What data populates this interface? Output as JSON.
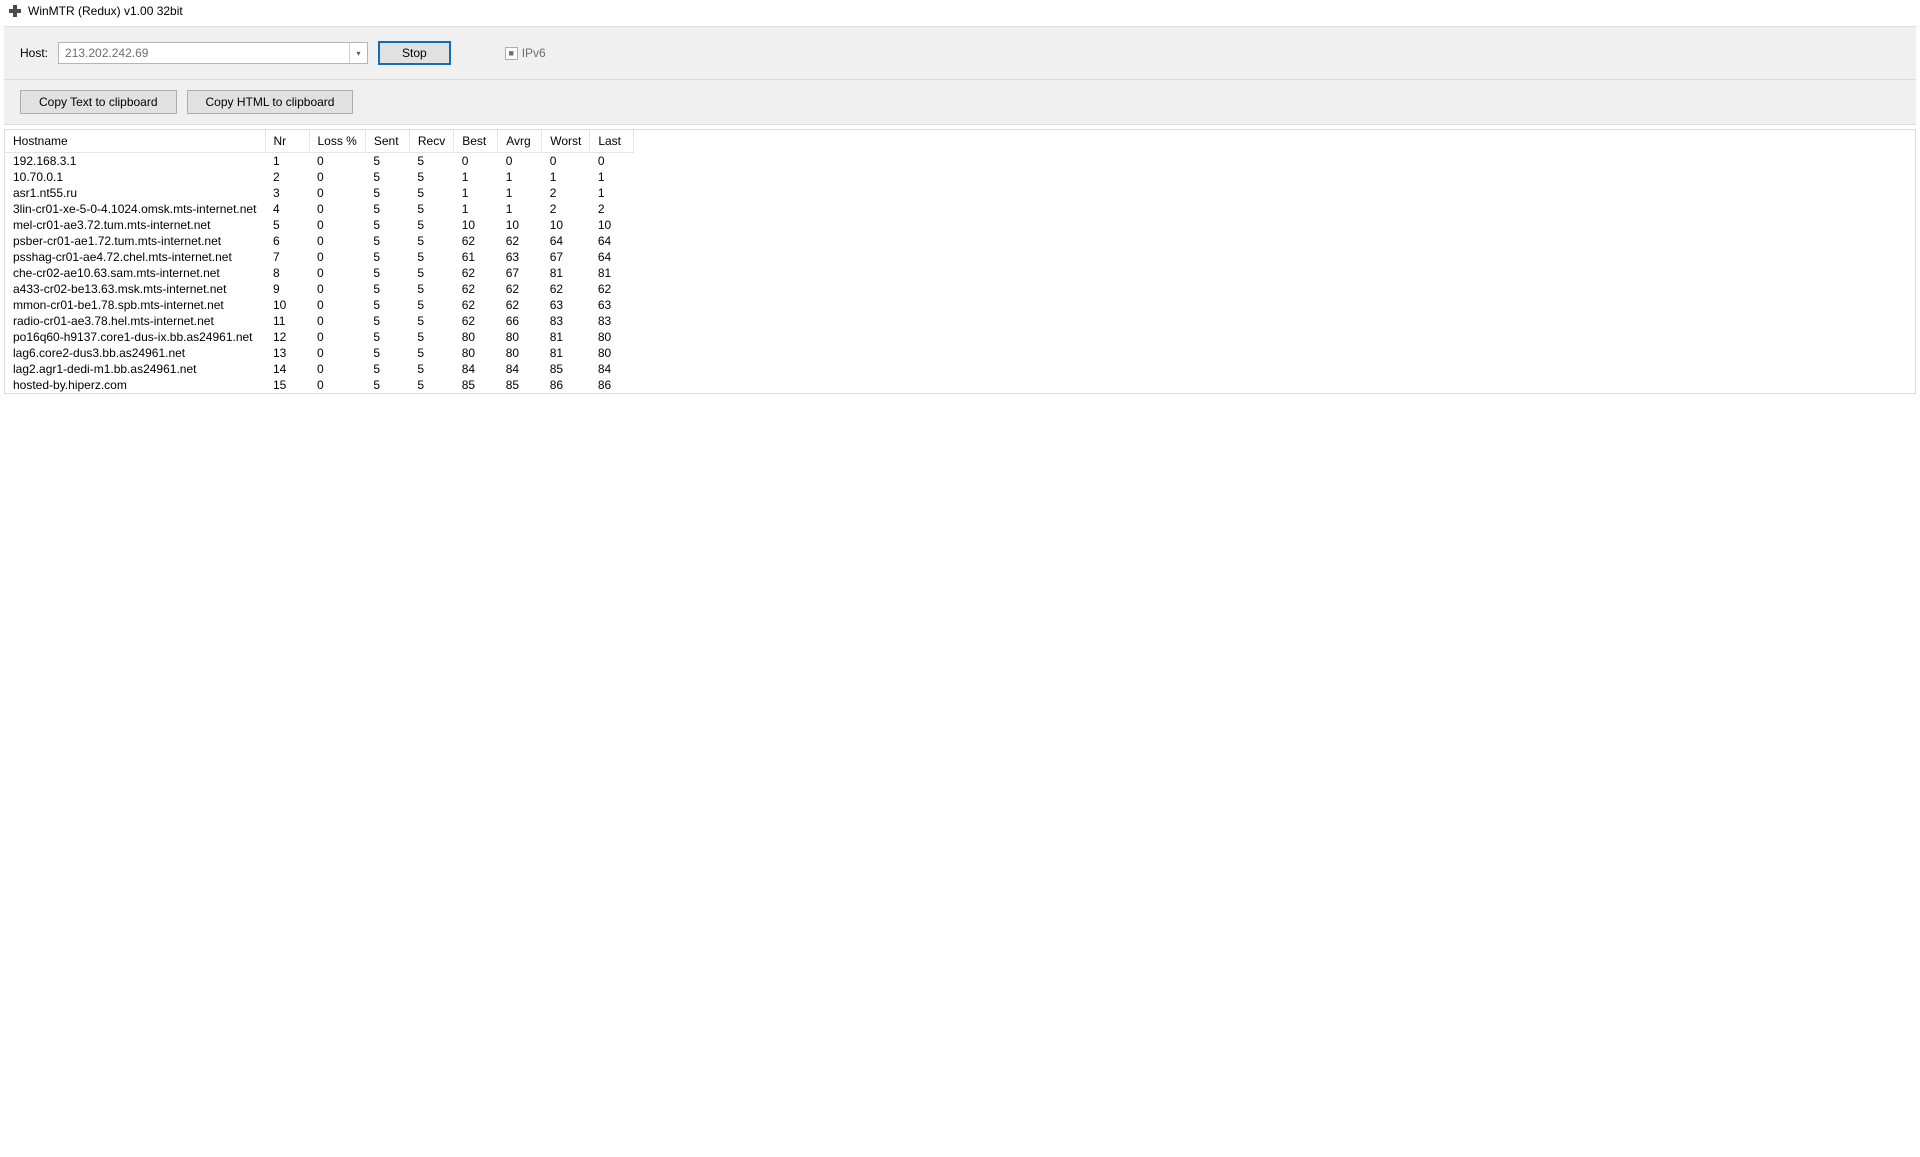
{
  "titlebar": {
    "title": "WinMTR (Redux) v1.00 32bit"
  },
  "toolbar": {
    "host_label": "Host:",
    "host_value": "213.202.242.69",
    "stop_label": "Stop",
    "ipv6_label": "IPv6"
  },
  "secondbar": {
    "copy_text_label": "Copy Text to clipboard",
    "copy_html_label": "Copy HTML to clipboard"
  },
  "table": {
    "headers": {
      "hostname": "Hostname",
      "nr": "Nr",
      "loss": "Loss %",
      "sent": "Sent",
      "recv": "Recv",
      "best": "Best",
      "avrg": "Avrg",
      "worst": "Worst",
      "last": "Last"
    },
    "rows": [
      {
        "hostname": "192.168.3.1",
        "nr": "1",
        "loss": "0",
        "sent": "5",
        "recv": "5",
        "best": "0",
        "avrg": "0",
        "worst": "0",
        "last": "0"
      },
      {
        "hostname": "10.70.0.1",
        "nr": "2",
        "loss": "0",
        "sent": "5",
        "recv": "5",
        "best": "1",
        "avrg": "1",
        "worst": "1",
        "last": "1"
      },
      {
        "hostname": "asr1.nt55.ru",
        "nr": "3",
        "loss": "0",
        "sent": "5",
        "recv": "5",
        "best": "1",
        "avrg": "1",
        "worst": "2",
        "last": "1"
      },
      {
        "hostname": "3lin-cr01-xe-5-0-4.1024.omsk.mts-internet.net",
        "nr": "4",
        "loss": "0",
        "sent": "5",
        "recv": "5",
        "best": "1",
        "avrg": "1",
        "worst": "2",
        "last": "2"
      },
      {
        "hostname": "mel-cr01-ae3.72.tum.mts-internet.net",
        "nr": "5",
        "loss": "0",
        "sent": "5",
        "recv": "5",
        "best": "10",
        "avrg": "10",
        "worst": "10",
        "last": "10"
      },
      {
        "hostname": "psber-cr01-ae1.72.tum.mts-internet.net",
        "nr": "6",
        "loss": "0",
        "sent": "5",
        "recv": "5",
        "best": "62",
        "avrg": "62",
        "worst": "64",
        "last": "64"
      },
      {
        "hostname": "psshag-cr01-ae4.72.chel.mts-internet.net",
        "nr": "7",
        "loss": "0",
        "sent": "5",
        "recv": "5",
        "best": "61",
        "avrg": "63",
        "worst": "67",
        "last": "64"
      },
      {
        "hostname": "che-cr02-ae10.63.sam.mts-internet.net",
        "nr": "8",
        "loss": "0",
        "sent": "5",
        "recv": "5",
        "best": "62",
        "avrg": "67",
        "worst": "81",
        "last": "81"
      },
      {
        "hostname": "a433-cr02-be13.63.msk.mts-internet.net",
        "nr": "9",
        "loss": "0",
        "sent": "5",
        "recv": "5",
        "best": "62",
        "avrg": "62",
        "worst": "62",
        "last": "62"
      },
      {
        "hostname": "mmon-cr01-be1.78.spb.mts-internet.net",
        "nr": "10",
        "loss": "0",
        "sent": "5",
        "recv": "5",
        "best": "62",
        "avrg": "62",
        "worst": "63",
        "last": "63"
      },
      {
        "hostname": "radio-cr01-ae3.78.hel.mts-internet.net",
        "nr": "11",
        "loss": "0",
        "sent": "5",
        "recv": "5",
        "best": "62",
        "avrg": "66",
        "worst": "83",
        "last": "83"
      },
      {
        "hostname": "po16q60-h9137.core1-dus-ix.bb.as24961.net",
        "nr": "12",
        "loss": "0",
        "sent": "5",
        "recv": "5",
        "best": "80",
        "avrg": "80",
        "worst": "81",
        "last": "80"
      },
      {
        "hostname": "lag6.core2-dus3.bb.as24961.net",
        "nr": "13",
        "loss": "0",
        "sent": "5",
        "recv": "5",
        "best": "80",
        "avrg": "80",
        "worst": "81",
        "last": "80"
      },
      {
        "hostname": "lag2.agr1-dedi-m1.bb.as24961.net",
        "nr": "14",
        "loss": "0",
        "sent": "5",
        "recv": "5",
        "best": "84",
        "avrg": "84",
        "worst": "85",
        "last": "84"
      },
      {
        "hostname": "hosted-by.hiperz.com",
        "nr": "15",
        "loss": "0",
        "sent": "5",
        "recv": "5",
        "best": "85",
        "avrg": "85",
        "worst": "86",
        "last": "86"
      }
    ]
  }
}
